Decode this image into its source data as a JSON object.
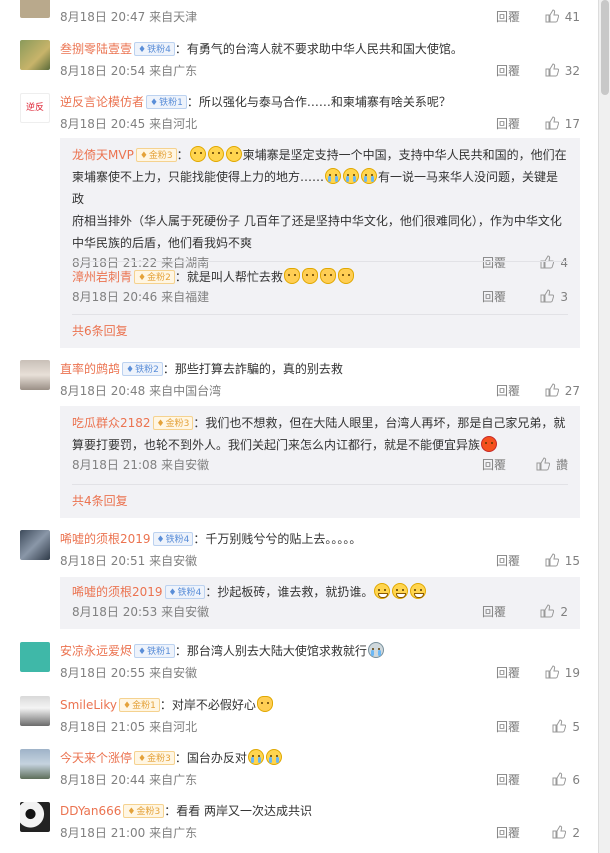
{
  "comments": [
    {
      "id": "c0",
      "user": "",
      "badge": "",
      "text": "",
      "time": "8月18日 20:47 来自天津",
      "reply": "回覆",
      "likes": "41"
    },
    {
      "id": "c1",
      "user": "叁捌零陆壹壹",
      "badge": "铁粉4",
      "text": "有勇气的台湾人就不要求助中华人民共和国大使馆。",
      "time": "8月18日 20:54 来自广东",
      "reply": "回覆",
      "likes": "32"
    },
    {
      "id": "c2",
      "user": "逆反言论模仿者",
      "badge": "铁粉1",
      "text": "所以强化与泰马合作……和柬埔寨有啥关系呢？",
      "time": "8月18日 20:45 来自河北",
      "reply": "回覆",
      "likes": "17",
      "subs": [
        {
          "user": "龙倚天MVP",
          "badge": "金粉3",
          "text_a": "柬埔寨是坚定支持一个中国，支持中华人民共和国的，他们在",
          "text_b": "柬埔寨使不上力，只能找能使得上力的地方……",
          "text_c": "有一说一马来华人没问题，关键是政",
          "text_d": "府相当排外（华人属于死硬份子 几百年了还是坚持中华文化，他们很难同化），作为中华文化",
          "text_e": "中华民族的后盾，他们看我妈不爽",
          "time": "8月18日 21:22 来自湖南",
          "reply": "回覆",
          "likes": "4"
        },
        {
          "user": "漳州岩刺青",
          "badge": "金粉2",
          "text": "就是叫人帮忙去救",
          "time": "8月18日 20:46 来自福建",
          "reply": "回覆",
          "likes": "3"
        }
      ],
      "more": "共6条回复"
    },
    {
      "id": "c3",
      "user": "直率的鹧鸪",
      "badge": "铁粉2",
      "text": "那些打算去詐騙的，真的别去救",
      "time": "8月18日 20:48 来自中国台湾",
      "reply": "回覆",
      "likes": "27",
      "subs": [
        {
          "user": "吃瓜群众2182",
          "badge": "金粉3",
          "text_a": "我们也不想救，但在大陆人眼里，台湾人再坏，那是自己家兄弟，就",
          "text_b": "算要打要罚，也轮不到外人。我们关起门来怎么内讧都行，就是不能便宜异族",
          "time": "8月18日 21:08 来自安徽",
          "reply": "回覆",
          "likes": "讚"
        }
      ],
      "more": "共4条回复"
    },
    {
      "id": "c4",
      "user": "唏嘘的须根2019",
      "badge": "铁粉4",
      "text": "千万别贱兮兮的贴上去。。。。。",
      "time": "8月18日 20:51 来自安徽",
      "reply": "回覆",
      "likes": "15",
      "subs": [
        {
          "user": "唏嘘的须根2019",
          "badge": "铁粉4",
          "text": "抄起板砖，谁去救，就扔谁。",
          "time": "8月18日 20:53 来自安徽",
          "reply": "回覆",
          "likes": "2"
        }
      ]
    },
    {
      "id": "c5",
      "user": "安凉永远爱烬",
      "badge": "铁粉1",
      "text": "那台湾人别去大陆大使馆求救就行",
      "time": "8月18日 20:55 来自安徽",
      "reply": "回覆",
      "likes": "19"
    },
    {
      "id": "c6",
      "user": "SmileLiky",
      "badge": "金粉1",
      "text": "对岸不必假好心",
      "time": "8月18日 21:05 来自河北",
      "reply": "回覆",
      "likes": "5"
    },
    {
      "id": "c7",
      "user": "今天来个涨停",
      "badge": "金粉3",
      "text": "国台办反对",
      "time": "8月18日 20:44 来自广东",
      "reply": "回覆",
      "likes": "6"
    },
    {
      "id": "c8",
      "user": "DDYan666",
      "badge": "金粉3",
      "text": "看看 两岸又一次达成共识",
      "time": "8月18日 21:00 来自广东",
      "reply": "回覆",
      "likes": "2"
    }
  ],
  "avatar_text_c2": "逆反"
}
